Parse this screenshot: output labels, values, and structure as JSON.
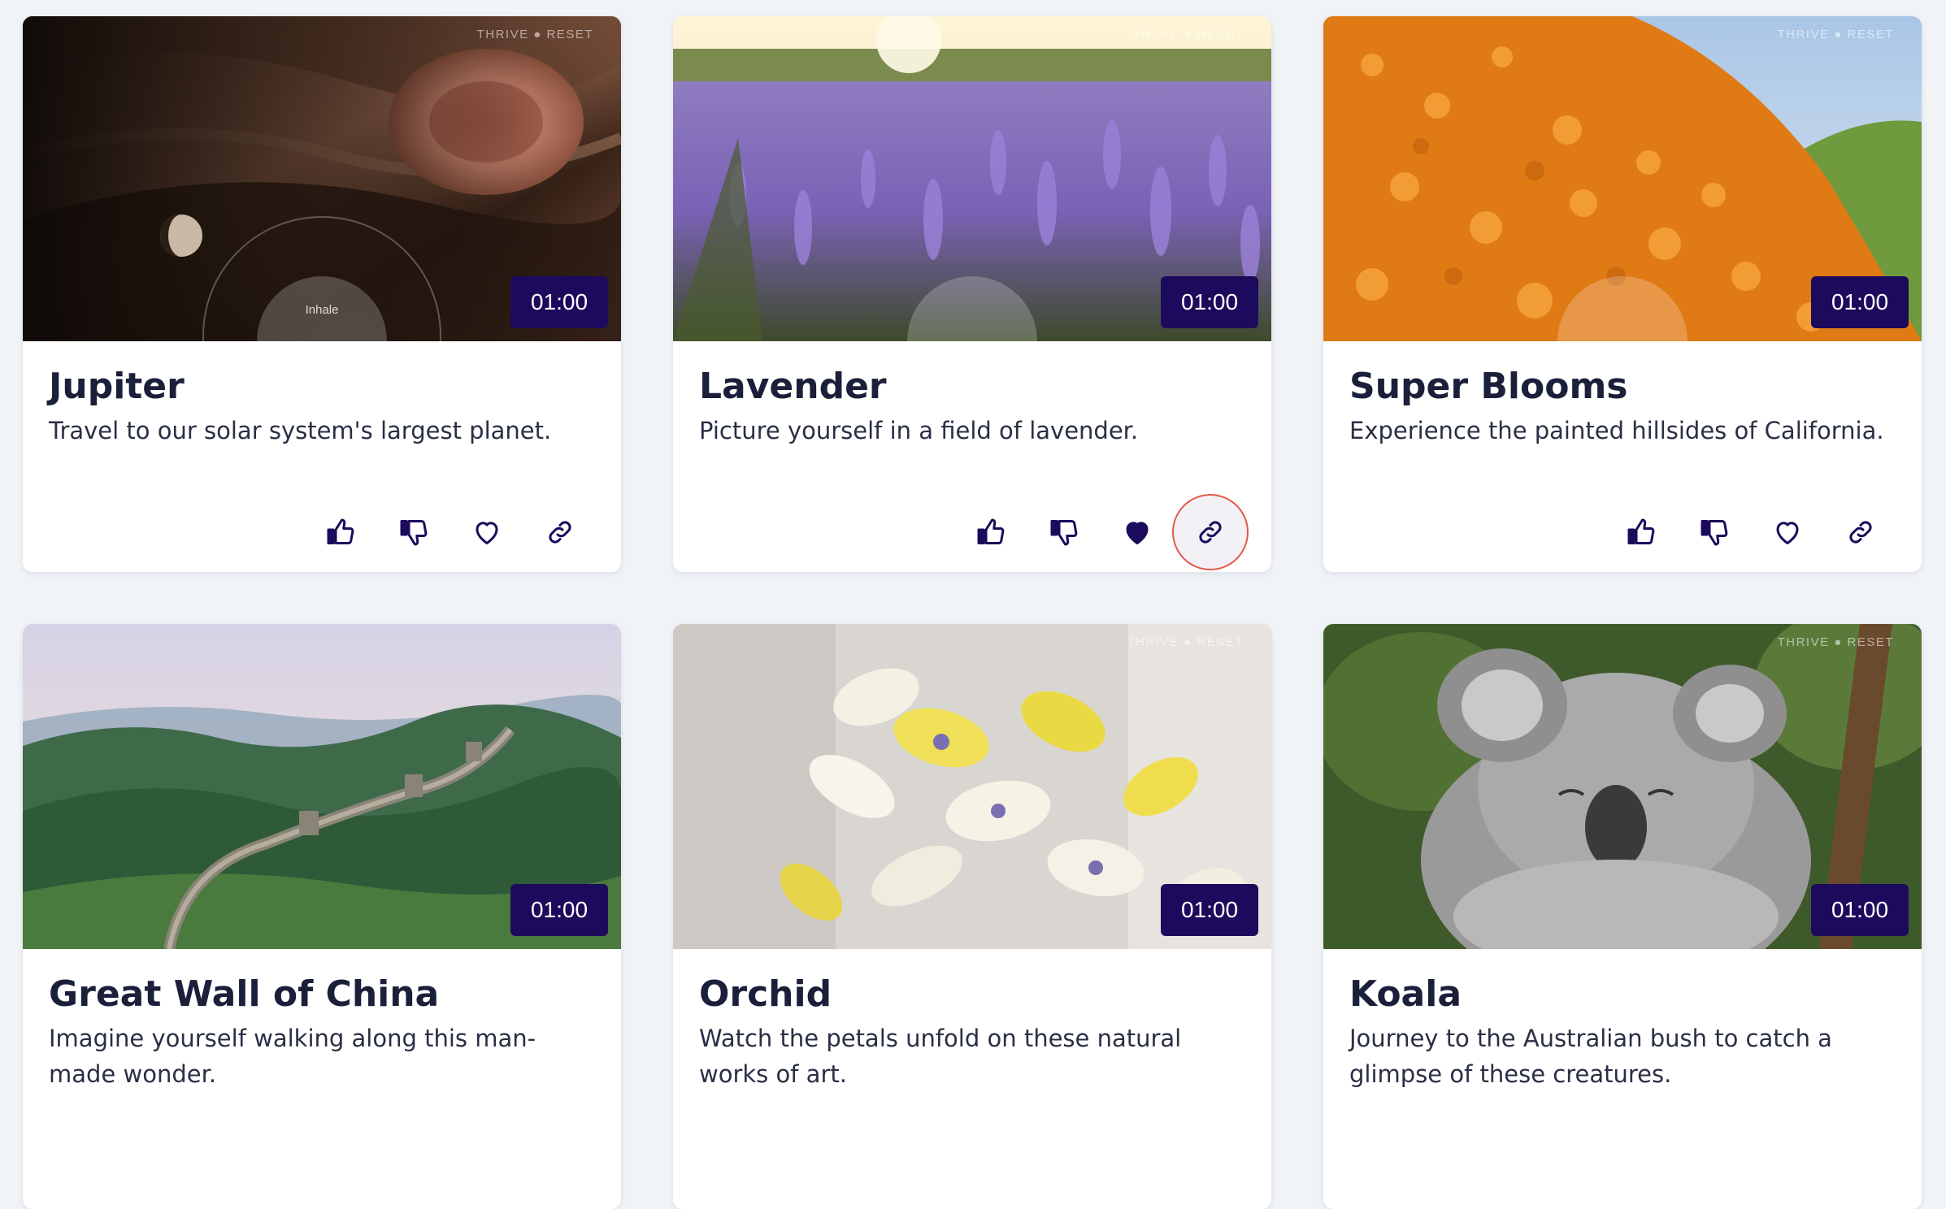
{
  "brand_watermark": "THRIVE ● RESET",
  "breath_label": "Inhale",
  "colors": {
    "duration_bg": "#1c0b5c",
    "icon_color": "#1c0b5c",
    "focus_ring": "#e25a48",
    "page_bg": "#f1f4f7"
  },
  "cards": [
    {
      "title": "Jupiter",
      "description": "Travel to our solar system's largest planet.",
      "duration": "01:00",
      "liked": false,
      "favorited": false
    },
    {
      "title": "Lavender",
      "description": "Picture yourself in a field of lavender.",
      "duration": "01:00",
      "liked": false,
      "favorited": true
    },
    {
      "title": "Super Blooms",
      "description": "Experience the painted hillsides of California.",
      "duration": "01:00",
      "liked": false,
      "favorited": false
    },
    {
      "title": "Great Wall of China",
      "description": "Imagine yourself walking along this man-made wonder.",
      "duration": "01:00"
    },
    {
      "title": "Orchid",
      "description": "Watch the petals unfold on these natural works of art.",
      "duration": "01:00"
    },
    {
      "title": "Koala",
      "description": "Journey to the Australian bush to catch a glimpse of these creatures.",
      "duration": "01:00"
    }
  ],
  "action_icons": [
    "thumbs-up-icon",
    "thumbs-down-icon",
    "heart-icon",
    "link-icon"
  ]
}
